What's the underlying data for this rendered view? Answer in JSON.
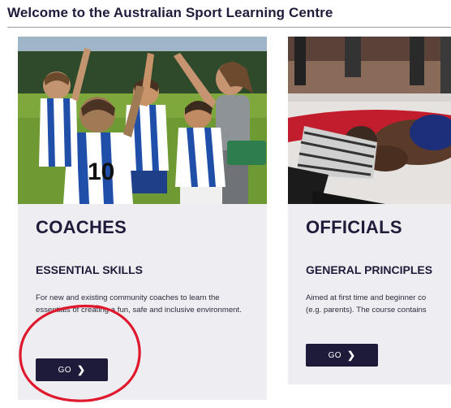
{
  "page": {
    "title": "Welcome to the Australian Sport Learning Centre"
  },
  "cards": [
    {
      "title": "COACHES",
      "subtitle": "ESSENTIAL SKILLS",
      "description": "For new and existing community coaches to learn the essentials of creating a fun, safe and inclusive environment.",
      "button_label": "GO",
      "button_icon": "chevron-right-icon",
      "image": "coach-with-young-soccer-team-photo"
    },
    {
      "title": "OFFICIALS",
      "subtitle": "GENERAL PRINCIPLES",
      "description": "Aimed at first time and beginner co",
      "description_line2": "(e.g. parents). The course contains",
      "button_label": "GO",
      "button_icon": "chevron-right-icon",
      "image": "wrestling-referee-photo"
    }
  ],
  "annotation": {
    "shape": "hand-drawn-circle",
    "color": "#e0182d"
  },
  "colors": {
    "brand_navy": "#1d1a3a",
    "card_bg": "#eeeef2"
  }
}
